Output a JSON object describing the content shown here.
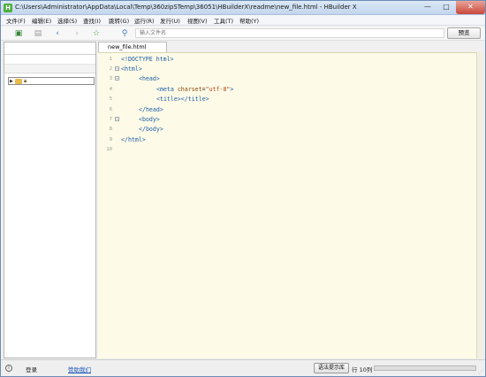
{
  "window": {
    "title": "C:\\Users\\Administrator\\AppData\\Local\\Temp\\360zipSTemp\\36051\\HBuilderX\\readme\\new_file.html - HBuilder X",
    "app_icon": "H",
    "minimize_glyph": "—",
    "maximize_glyph": "□",
    "close_glyph": "✕"
  },
  "menu": {
    "items": [
      "文件(F)",
      "编辑(E)",
      "选择(S)",
      "查找(I)",
      "跳转(G)",
      "运行(R)",
      "发行(U)",
      "视图(V)",
      "工具(T)",
      "帮助(Y)"
    ]
  },
  "toolbar": {
    "icons": [
      "new-file-icon",
      "save-icon",
      "back-icon",
      "forward-icon",
      "star-icon",
      "search-file-icon"
    ],
    "search_placeholder": "输入文件名",
    "preview_label": "预览"
  },
  "editor": {
    "tab_label": "new_file.html",
    "lines": [
      {
        "n": "1"
      },
      {
        "n": "2"
      },
      {
        "n": "3"
      },
      {
        "n": "4"
      },
      {
        "n": "5"
      },
      {
        "n": "6"
      },
      {
        "n": "7"
      },
      {
        "n": "8"
      },
      {
        "n": "9"
      },
      {
        "n": "10"
      }
    ],
    "code": {
      "l1": "<!DOCTYPE html>",
      "l2": "<html>",
      "l3": "<head>",
      "l4_open": "<meta ",
      "l4_attr": "charset",
      "l4_eq": "=",
      "l4_val": "\"utf-8\"",
      "l4_close": ">",
      "l5": "<title></title>",
      "l6": "</head>",
      "l7": "<body>",
      "l8": "</body>",
      "l9": "</html>"
    }
  },
  "statusbar": {
    "login_label": "登录",
    "help_label": "赞助我们",
    "suggest_label": "语法提示库",
    "cursor_position": "行 10列"
  },
  "colors": {
    "editor_background": "#fdfbe7",
    "tag_color": "#1e5ca7",
    "link_color": "#1b55b8"
  }
}
